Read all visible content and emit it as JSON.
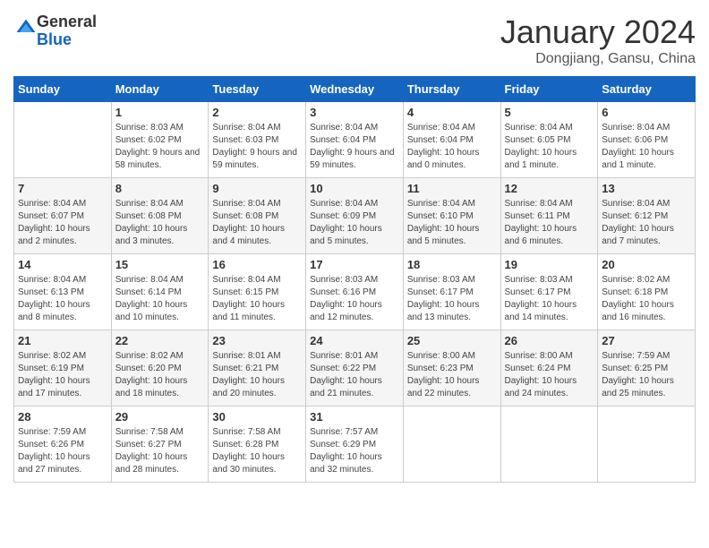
{
  "header": {
    "logo": {
      "general": "General",
      "blue": "Blue"
    },
    "title": "January 2024",
    "subtitle": "Dongjiang, Gansu, China"
  },
  "calendar": {
    "weekdays": [
      "Sunday",
      "Monday",
      "Tuesday",
      "Wednesday",
      "Thursday",
      "Friday",
      "Saturday"
    ],
    "weeks": [
      [
        {
          "day": "",
          "sunrise": "",
          "sunset": "",
          "daylight": ""
        },
        {
          "day": "1",
          "sunrise": "Sunrise: 8:03 AM",
          "sunset": "Sunset: 6:02 PM",
          "daylight": "Daylight: 9 hours and 58 minutes."
        },
        {
          "day": "2",
          "sunrise": "Sunrise: 8:04 AM",
          "sunset": "Sunset: 6:03 PM",
          "daylight": "Daylight: 9 hours and 59 minutes."
        },
        {
          "day": "3",
          "sunrise": "Sunrise: 8:04 AM",
          "sunset": "Sunset: 6:04 PM",
          "daylight": "Daylight: 9 hours and 59 minutes."
        },
        {
          "day": "4",
          "sunrise": "Sunrise: 8:04 AM",
          "sunset": "Sunset: 6:04 PM",
          "daylight": "Daylight: 10 hours and 0 minutes."
        },
        {
          "day": "5",
          "sunrise": "Sunrise: 8:04 AM",
          "sunset": "Sunset: 6:05 PM",
          "daylight": "Daylight: 10 hours and 1 minute."
        },
        {
          "day": "6",
          "sunrise": "Sunrise: 8:04 AM",
          "sunset": "Sunset: 6:06 PM",
          "daylight": "Daylight: 10 hours and 1 minute."
        }
      ],
      [
        {
          "day": "7",
          "sunrise": "Sunrise: 8:04 AM",
          "sunset": "Sunset: 6:07 PM",
          "daylight": "Daylight: 10 hours and 2 minutes."
        },
        {
          "day": "8",
          "sunrise": "Sunrise: 8:04 AM",
          "sunset": "Sunset: 6:08 PM",
          "daylight": "Daylight: 10 hours and 3 minutes."
        },
        {
          "day": "9",
          "sunrise": "Sunrise: 8:04 AM",
          "sunset": "Sunset: 6:08 PM",
          "daylight": "Daylight: 10 hours and 4 minutes."
        },
        {
          "day": "10",
          "sunrise": "Sunrise: 8:04 AM",
          "sunset": "Sunset: 6:09 PM",
          "daylight": "Daylight: 10 hours and 5 minutes."
        },
        {
          "day": "11",
          "sunrise": "Sunrise: 8:04 AM",
          "sunset": "Sunset: 6:10 PM",
          "daylight": "Daylight: 10 hours and 5 minutes."
        },
        {
          "day": "12",
          "sunrise": "Sunrise: 8:04 AM",
          "sunset": "Sunset: 6:11 PM",
          "daylight": "Daylight: 10 hours and 6 minutes."
        },
        {
          "day": "13",
          "sunrise": "Sunrise: 8:04 AM",
          "sunset": "Sunset: 6:12 PM",
          "daylight": "Daylight: 10 hours and 7 minutes."
        }
      ],
      [
        {
          "day": "14",
          "sunrise": "Sunrise: 8:04 AM",
          "sunset": "Sunset: 6:13 PM",
          "daylight": "Daylight: 10 hours and 8 minutes."
        },
        {
          "day": "15",
          "sunrise": "Sunrise: 8:04 AM",
          "sunset": "Sunset: 6:14 PM",
          "daylight": "Daylight: 10 hours and 10 minutes."
        },
        {
          "day": "16",
          "sunrise": "Sunrise: 8:04 AM",
          "sunset": "Sunset: 6:15 PM",
          "daylight": "Daylight: 10 hours and 11 minutes."
        },
        {
          "day": "17",
          "sunrise": "Sunrise: 8:03 AM",
          "sunset": "Sunset: 6:16 PM",
          "daylight": "Daylight: 10 hours and 12 minutes."
        },
        {
          "day": "18",
          "sunrise": "Sunrise: 8:03 AM",
          "sunset": "Sunset: 6:17 PM",
          "daylight": "Daylight: 10 hours and 13 minutes."
        },
        {
          "day": "19",
          "sunrise": "Sunrise: 8:03 AM",
          "sunset": "Sunset: 6:17 PM",
          "daylight": "Daylight: 10 hours and 14 minutes."
        },
        {
          "day": "20",
          "sunrise": "Sunrise: 8:02 AM",
          "sunset": "Sunset: 6:18 PM",
          "daylight": "Daylight: 10 hours and 16 minutes."
        }
      ],
      [
        {
          "day": "21",
          "sunrise": "Sunrise: 8:02 AM",
          "sunset": "Sunset: 6:19 PM",
          "daylight": "Daylight: 10 hours and 17 minutes."
        },
        {
          "day": "22",
          "sunrise": "Sunrise: 8:02 AM",
          "sunset": "Sunset: 6:20 PM",
          "daylight": "Daylight: 10 hours and 18 minutes."
        },
        {
          "day": "23",
          "sunrise": "Sunrise: 8:01 AM",
          "sunset": "Sunset: 6:21 PM",
          "daylight": "Daylight: 10 hours and 20 minutes."
        },
        {
          "day": "24",
          "sunrise": "Sunrise: 8:01 AM",
          "sunset": "Sunset: 6:22 PM",
          "daylight": "Daylight: 10 hours and 21 minutes."
        },
        {
          "day": "25",
          "sunrise": "Sunrise: 8:00 AM",
          "sunset": "Sunset: 6:23 PM",
          "daylight": "Daylight: 10 hours and 22 minutes."
        },
        {
          "day": "26",
          "sunrise": "Sunrise: 8:00 AM",
          "sunset": "Sunset: 6:24 PM",
          "daylight": "Daylight: 10 hours and 24 minutes."
        },
        {
          "day": "27",
          "sunrise": "Sunrise: 7:59 AM",
          "sunset": "Sunset: 6:25 PM",
          "daylight": "Daylight: 10 hours and 25 minutes."
        }
      ],
      [
        {
          "day": "28",
          "sunrise": "Sunrise: 7:59 AM",
          "sunset": "Sunset: 6:26 PM",
          "daylight": "Daylight: 10 hours and 27 minutes."
        },
        {
          "day": "29",
          "sunrise": "Sunrise: 7:58 AM",
          "sunset": "Sunset: 6:27 PM",
          "daylight": "Daylight: 10 hours and 28 minutes."
        },
        {
          "day": "30",
          "sunrise": "Sunrise: 7:58 AM",
          "sunset": "Sunset: 6:28 PM",
          "daylight": "Daylight: 10 hours and 30 minutes."
        },
        {
          "day": "31",
          "sunrise": "Sunrise: 7:57 AM",
          "sunset": "Sunset: 6:29 PM",
          "daylight": "Daylight: 10 hours and 32 minutes."
        },
        {
          "day": "",
          "sunrise": "",
          "sunset": "",
          "daylight": ""
        },
        {
          "day": "",
          "sunrise": "",
          "sunset": "",
          "daylight": ""
        },
        {
          "day": "",
          "sunrise": "",
          "sunset": "",
          "daylight": ""
        }
      ]
    ]
  }
}
